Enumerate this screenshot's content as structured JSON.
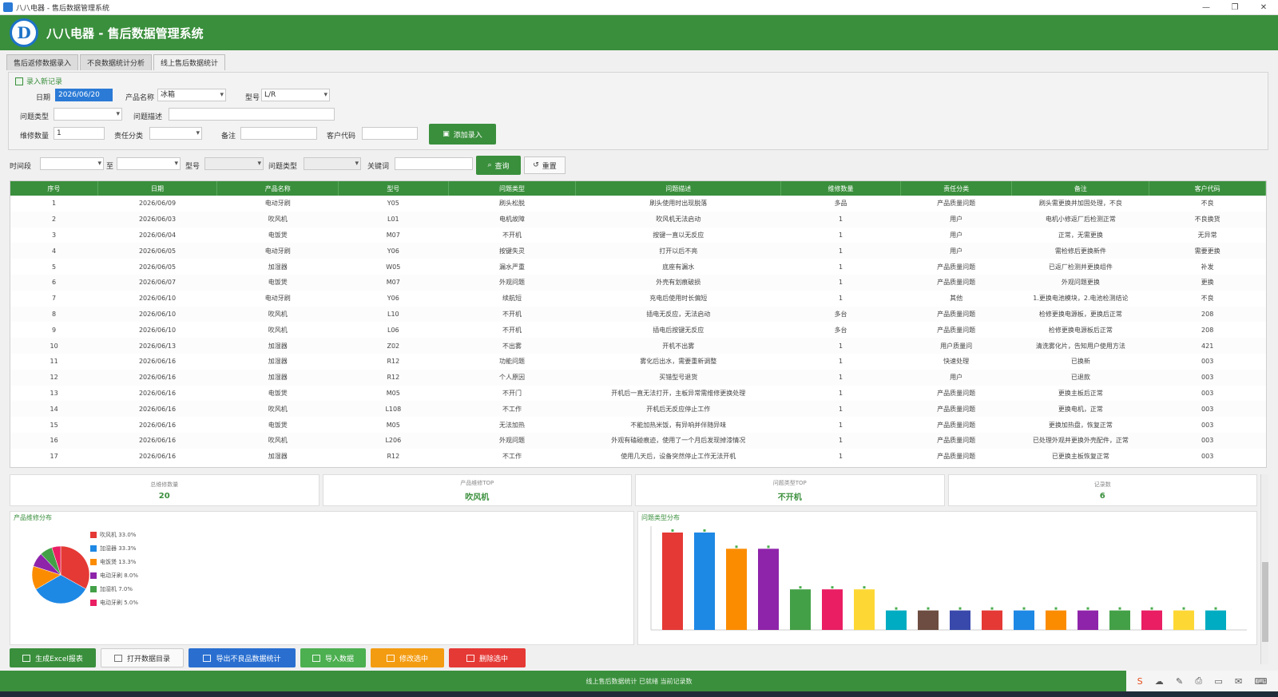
{
  "window": {
    "title": "八八电器 - 售后数据管理系统"
  },
  "header": {
    "title": "八八电器 - 售后数据管理系统",
    "logo": "D"
  },
  "tabs": [
    "售后返修数据录入",
    "不良数据统计分析",
    "线上售后数据统计"
  ],
  "form": {
    "group_title": "录入新记录",
    "date_label": "日期",
    "date_value": "2026/06/20",
    "product_label": "产品名称",
    "product_value": "冰箱",
    "model_label": "型号",
    "model_value": "L/R",
    "problem_type_label": "问题类型",
    "problem_desc_label": "问题描述",
    "qty_label": "维修数量",
    "qty_value": "1",
    "category_label": "责任分类",
    "remark_label": "备注",
    "customer_label": "客户代码",
    "add_button": "添加录入"
  },
  "search": {
    "time_label": "时间段",
    "to_label": "至",
    "product_label": "型号",
    "type_label": "问题类型",
    "keyword_label": "关键词",
    "query_button": "查询",
    "reset_button": "重置"
  },
  "table": {
    "columns": [
      "序号",
      "日期",
      "产品名称",
      "型号",
      "问题类型",
      "问题描述",
      "维修数量",
      "责任分类",
      "备注",
      "客户代码"
    ],
    "rows": [
      [
        "1",
        "2026/06/09",
        "电动牙刷",
        "Y05",
        "刷头松脱",
        "刷头使用时出现脱落",
        "多品",
        "产品质量问题",
        "刷头需更换并加固处理，不良",
        "不良"
      ],
      [
        "2",
        "2026/06/03",
        "吹风机",
        "L01",
        "电机故障",
        "吹风机无法启动",
        "1",
        "用户",
        "电机小修返厂后检测正常",
        "不良换货"
      ],
      [
        "3",
        "2026/06/04",
        "电饭煲",
        "M07",
        "不开机",
        "按键一直以无反应",
        "1",
        "用户",
        "正常，无需更换",
        "无异常"
      ],
      [
        "4",
        "2026/06/05",
        "电动牙刷",
        "Y06",
        "按键失灵",
        "打开以后不亮",
        "1",
        "用户",
        "需检修后更换新件",
        "需要更换"
      ],
      [
        "5",
        "2026/06/05",
        "加湿器",
        "W05",
        "漏水严重",
        "底座有漏水",
        "1",
        "产品质量问题",
        "已返厂检测并更换组件",
        "补发"
      ],
      [
        "6",
        "2026/06/07",
        "电饭煲",
        "M07",
        "外观问题",
        "外壳有划痕破损",
        "1",
        "产品质量问题",
        "外观问题更换",
        "更换"
      ],
      [
        "7",
        "2026/06/10",
        "电动牙刷",
        "Y06",
        "续航短",
        "充电后使用时长偏短",
        "1",
        "其他",
        "1.更换电池模块，2.电池检测结论",
        "不良"
      ],
      [
        "8",
        "2026/06/10",
        "吹风机",
        "L10",
        "不开机",
        "插电无反应，无法启动",
        "多台",
        "产品质量问题",
        "检修更换电源板，更换后正常",
        "208"
      ],
      [
        "9",
        "2026/06/10",
        "吹风机",
        "L06",
        "不开机",
        "插电后按键无反应",
        "多台",
        "产品质量问题",
        "检修更换电源板后正常",
        "208"
      ],
      [
        "10",
        "2026/06/13",
        "加湿器",
        "Z02",
        "不出雾",
        "开机不出雾",
        "1",
        "用户质量问",
        "清洗雾化片，告知用户使用方法",
        "421"
      ],
      [
        "11",
        "2026/06/16",
        "加湿器",
        "R12",
        "功能问题",
        "雾化后出水，需要重新调整",
        "1",
        "快速处理",
        "已换新",
        "003"
      ],
      [
        "12",
        "2026/06/16",
        "加湿器",
        "R12",
        "个人原因",
        "买错型号退货",
        "1",
        "用户",
        "已退款",
        "003"
      ],
      [
        "13",
        "2026/06/16",
        "电饭煲",
        "M05",
        "不开门",
        "开机后一直无法打开，主板异常需维修更换处理",
        "1",
        "产品质量问题",
        "更换主板后正常",
        "003"
      ],
      [
        "14",
        "2026/06/16",
        "吹风机",
        "L108",
        "不工作",
        "开机后无反应停止工作",
        "1",
        "产品质量问题",
        "更换电机，正常",
        "003"
      ],
      [
        "15",
        "2026/06/16",
        "电饭煲",
        "M05",
        "无法加热",
        "不能加热米饭，有异响并伴随异味",
        "1",
        "产品质量问题",
        "更换加热盘，恢复正常",
        "003"
      ],
      [
        "16",
        "2026/06/16",
        "吹风机",
        "L206",
        "外观问题",
        "外观有磕碰痕迹，使用了一个月后发现掉漆情况",
        "1",
        "产品质量问题",
        "已处理外观并更换外壳配件，正常",
        "003"
      ],
      [
        "17",
        "2026/06/16",
        "加湿器",
        "R12",
        "不工作",
        "使用几天后，设备突然停止工作无法开机",
        "1",
        "产品质量问题",
        "已更换主板恢复正常",
        "003"
      ]
    ]
  },
  "stats": [
    {
      "label": "总维修数量",
      "value": "20"
    },
    {
      "label": "产品维修TOP",
      "value": "吹风机"
    },
    {
      "label": "问题类型TOP",
      "value": "不开机"
    },
    {
      "label": "记录数",
      "value": "6"
    }
  ],
  "pie_panel": {
    "title": "产品维修分布",
    "slices": [
      {
        "label": "吹风机 33.0%",
        "value": 33.0,
        "color": "#e53935"
      },
      {
        "label": "加湿器 33.3%",
        "value": 33.3,
        "color": "#1e88e5"
      },
      {
        "label": "电饭煲 13.3%",
        "value": 13.3,
        "color": "#fb8c00"
      },
      {
        "label": "电动牙刷 8.0%",
        "value": 8.0,
        "color": "#8e24aa"
      },
      {
        "label": "加湿机 7.0%",
        "value": 7.0,
        "color": "#43a047"
      },
      {
        "label": "电动牙刷 5.0%",
        "value": 5.0,
        "color": "#e91e63"
      }
    ]
  },
  "bar_panel": {
    "title": "问题类型分布",
    "values": [
      6,
      6,
      5,
      5,
      2.5,
      2.5,
      2.5,
      1.2,
      1.2,
      1.2,
      1.2,
      1.2,
      1.2,
      1.2,
      1.2,
      1.2,
      1.2,
      1.2
    ],
    "colors": [
      "#e53935",
      "#1e88e5",
      "#fb8c00",
      "#8e24aa",
      "#43a047",
      "#e91e63",
      "#fdd835",
      "#00acc1",
      "#6d4c41",
      "#3949ab",
      "#e53935",
      "#1e88e5",
      "#fb8c00",
      "#8e24aa",
      "#43a047",
      "#e91e63",
      "#fdd835",
      "#00acc1"
    ],
    "ylim": [
      0,
      6
    ]
  },
  "actions": [
    {
      "label": "生成Excel报表",
      "color": "#3a8f3c"
    },
    {
      "label": "打开数据目录",
      "color": "#fafafa"
    },
    {
      "label": "导出不良品数据统计",
      "color": "#2a6fd0"
    },
    {
      "label": "导入数据",
      "color": "#4caf50"
    },
    {
      "label": "修改选中",
      "color": "#f39c12"
    },
    {
      "label": "删除选中",
      "color": "#e53935"
    }
  ],
  "status": {
    "text": "线上售后数据统计  已就绪  当前记录数"
  }
}
